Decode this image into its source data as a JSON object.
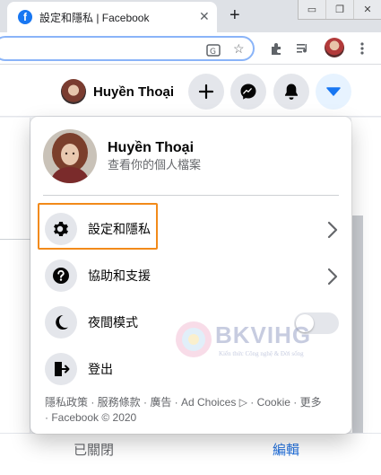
{
  "browser": {
    "tab_title": "設定和隱私 | Facebook",
    "tab_close": "✕",
    "new_tab": "+",
    "favicon": "f",
    "window_minimize": "▭",
    "window_restore": "❐",
    "window_close": "✕"
  },
  "header": {
    "user_name": "Huyền Thoại"
  },
  "menu": {
    "profile_name": "Huyền Thoại",
    "profile_subtitle": "查看你的個人檔案",
    "items": [
      {
        "label": "設定和隱私",
        "icon": "gear-icon",
        "has_chevron": true
      },
      {
        "label": "協助和支援",
        "icon": "question-icon",
        "has_chevron": true
      },
      {
        "label": "夜間模式",
        "icon": "moon-icon",
        "toggle_on": false
      },
      {
        "label": "登出",
        "icon": "logout-icon"
      }
    ],
    "footer_line1": "隱私政策 · 服務條款 · 廣告 · Ad Choices ▷ · Cookie · 更多",
    "footer_line2": "· Facebook © 2020"
  },
  "page": {
    "bottom_status": "已關閉",
    "bottom_edit": "編輯"
  },
  "watermark": {
    "brand": "BKVIHG",
    "tagline": "Kiến thức Công nghệ & Đời sống"
  },
  "colors": {
    "facebook_blue": "#1877f2",
    "highlight_orange": "#f28a1a"
  }
}
